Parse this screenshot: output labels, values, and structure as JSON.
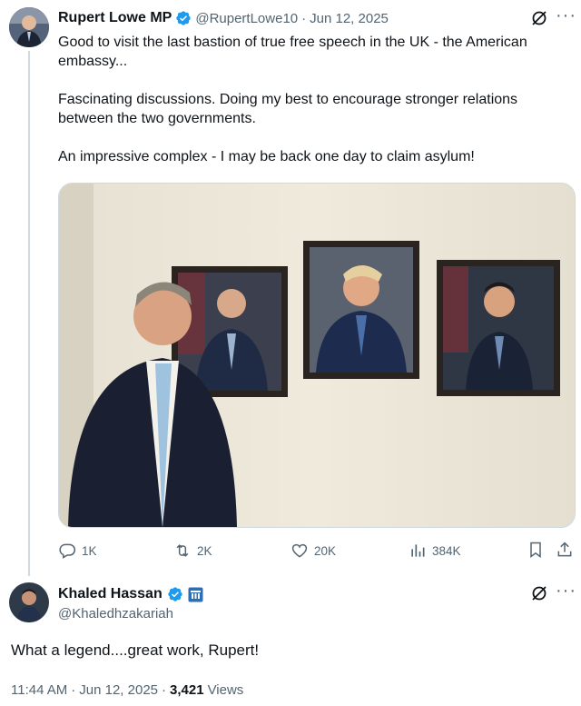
{
  "tweet": {
    "author_name": "Rupert Lowe MP",
    "handle": "@RupertLowe10",
    "date": "Jun 12, 2025",
    "separator": "·",
    "text": "Good to visit the last bastion of true free speech in the UK - the American embassy...\n\nFascinating discussions. Doing my best to encourage stronger relations between the two governments.\n\nAn impressive complex - I may be back one day to claim asylum!",
    "actions": {
      "replies": "1K",
      "reposts": "2K",
      "likes": "20K",
      "views": "384K"
    }
  },
  "reply": {
    "author_name": "Khaled Hassan",
    "handle": "@Khaledhzakariah",
    "text": "What a legend....great work, Rupert!",
    "time": "11:44 AM",
    "date": "Jun 12, 2025",
    "separator": "·",
    "views_count": "3,421",
    "views_label": "Views"
  },
  "colors": {
    "verified": "#1d9bf0",
    "muted": "#536471",
    "thread_line": "#cfd9de"
  },
  "icons": [
    "grok-icon",
    "more-icon",
    "reply-icon",
    "repost-icon",
    "like-icon",
    "views-icon",
    "bookmark-icon",
    "share-icon",
    "verified-badge-icon",
    "affiliate-badge-icon"
  ]
}
